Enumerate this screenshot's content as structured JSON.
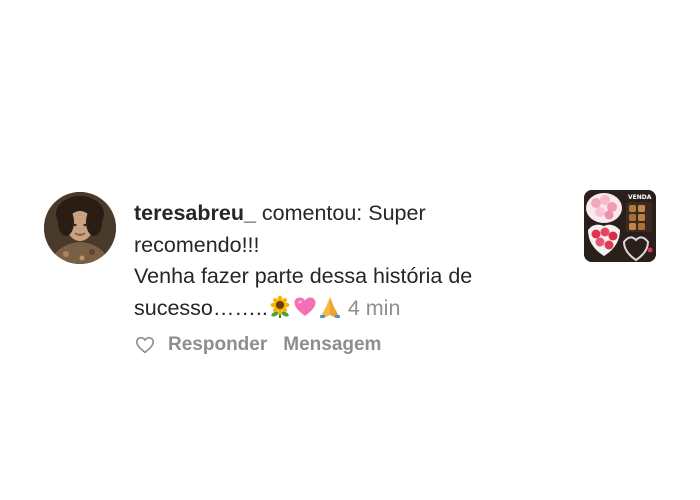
{
  "comment": {
    "username": "teresabreu_",
    "lines": [
      " comentou: Super",
      "recomendo!!!",
      "Venha fazer parte dessa história de",
      "sucesso…….."
    ],
    "emojis": [
      "sunflower-icon",
      "pink-heart-icon",
      "folded-hands-icon"
    ],
    "time": "4 min"
  },
  "actions": {
    "reply_label": "Responder",
    "message_label": "Mensagem"
  },
  "post_thumbnail": {
    "label": "VENDA"
  },
  "colors": {
    "text": "#262626",
    "secondary": "#8e8e8e",
    "background": "#ffffff"
  }
}
